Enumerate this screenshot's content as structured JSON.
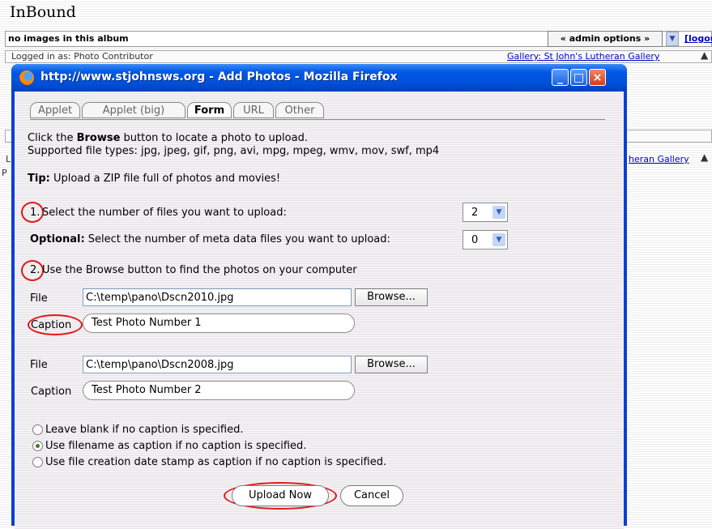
{
  "background_page": {
    "title": "InBound",
    "album_status": "no images in this album",
    "admin_options": "« admin options »",
    "logout": "[logout]",
    "logged_in_as": "Logged in as: Photo Contributor",
    "gallery_link_top": "Gallery: St John's Lutheran Gallery",
    "gallery_link_bottom": "heran Gallery",
    "left_fragment_1": "L",
    "left_fragment_2": "P"
  },
  "window": {
    "title": "http://www.stjohnsws.org - Add Photos - Mozilla Firefox",
    "controls": {
      "minimize": "_",
      "maximize": "□",
      "close": "×"
    }
  },
  "tabs": [
    {
      "label": "Applet",
      "active": false
    },
    {
      "label": "Applet (big)",
      "active": false
    },
    {
      "label": "Form",
      "active": true
    },
    {
      "label": "URL",
      "active": false
    },
    {
      "label": "Other",
      "active": false
    }
  ],
  "intro": {
    "line1_prefix": "Click the ",
    "line1_bold": "Browse",
    "line1_suffix": " button to locate a photo to upload.",
    "line2": "Supported file types: jpg, jpeg, gif, png, avi, mpg, mpeg, wmv, mov, swf, mp4",
    "tip_bold": "Tip:",
    "tip_text": " Upload a ZIP file full of photos and movies!"
  },
  "step1": {
    "number": "1.",
    "text": "Select the number of files you want to upload:",
    "files_value": "2",
    "optional_bold": "Optional:",
    "optional_text": " Select the number of meta data files you want to upload:",
    "meta_value": "0"
  },
  "step2": {
    "number": "2.",
    "text": "Use the Browse button to find the photos on your computer"
  },
  "files": [
    {
      "file_label": "File",
      "path": "C:\\temp\\pano\\Dscn2010.jpg",
      "browse": "Browse...",
      "caption_label": "Caption",
      "caption": "Test Photo Number 1"
    },
    {
      "file_label": "File",
      "path": "C:\\temp\\pano\\Dscn2008.jpg",
      "browse": "Browse...",
      "caption_label": "Caption",
      "caption": "Test Photo Number 2"
    }
  ],
  "caption_options": [
    {
      "label": "Leave blank if no caption is specified.",
      "selected": false
    },
    {
      "label": "Use filename as caption if no caption is specified.",
      "selected": true
    },
    {
      "label": "Use file creation date stamp as caption if no caption is specified.",
      "selected": false
    }
  ],
  "actions": {
    "upload": "Upload Now",
    "cancel": "Cancel"
  },
  "colors": {
    "annotation": "#e01818",
    "titlebar": "#0058e6"
  }
}
